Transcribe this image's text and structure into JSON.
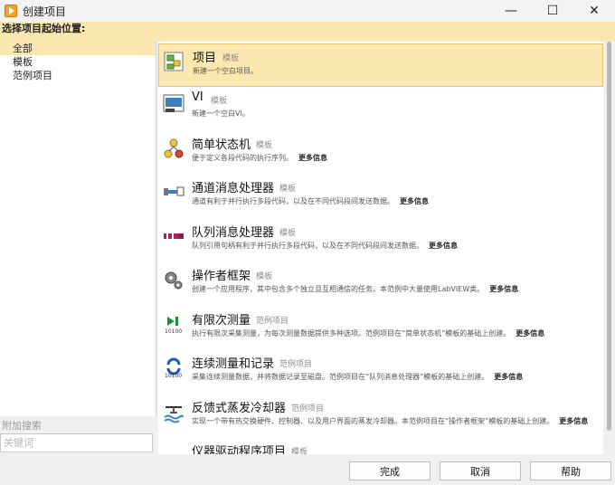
{
  "window": {
    "title": "创建项目",
    "minimize": "—",
    "maximize": "☐",
    "close": "✕"
  },
  "header": {
    "label": "选择项目起始位置:"
  },
  "tree": {
    "items": [
      "全部",
      "模板",
      "范例项目"
    ]
  },
  "search": {
    "label": "附加搜索",
    "placeholder": "关键词"
  },
  "items": [
    {
      "name": "项目",
      "type": "模板",
      "desc": "新建一个空白项目。",
      "more": "",
      "icon": "project-icon"
    },
    {
      "name": "VI",
      "type": "模板",
      "desc": "新建一个空白VI。",
      "more": "",
      "icon": "vi-icon"
    },
    {
      "name": "简单状态机",
      "type": "模板",
      "desc": "便于定义各段代码的执行序列。",
      "more": "更多信息",
      "icon": "state-machine-icon"
    },
    {
      "name": "通道消息处理器",
      "type": "模板",
      "desc": "通道有利于并行执行多段代码，以及在不同代码段间发送数据。",
      "more": "更多信息",
      "icon": "channel-icon"
    },
    {
      "name": "队列消息处理器",
      "type": "模板",
      "desc": "队列引用句柄有利于并行执行多段代码，以及在不同代码段间发送数据。",
      "more": "更多信息",
      "icon": "queue-icon"
    },
    {
      "name": "操作者框架",
      "type": "模板",
      "desc": "创建一个应用程序，其中包含多个独立且互相通信的任务。本范例中大量使用LabVIEW类。",
      "more": "更多信息",
      "icon": "gears-icon"
    },
    {
      "name": "有限次测量",
      "type": "范例项目",
      "desc": "执行有限次采集测量，为每次测量数据提供多种选项。范例项目在“简单状态机”模板的基础上创建。",
      "more": "更多信息",
      "icon": "finite-measure-icon"
    },
    {
      "name": "连续测量和记录",
      "type": "范例项目",
      "desc": "采集连续测量数据，并将数据记录至磁盘。范例项目在“队列消息处理器”模板的基础上创建。",
      "more": "更多信息",
      "icon": "continuous-log-icon"
    },
    {
      "name": "反馈式蒸发冷却器",
      "type": "范例项目",
      "desc": "实现一个带有热交换硬件、控制器、以及用户界面的蒸发冷却器。本范例项目在“操作者框架”模板的基础上创建。",
      "more": "更多信息",
      "icon": "cooler-icon"
    },
    {
      "name": "仪器驱动程序项目",
      "type": "模板",
      "desc": "",
      "more": "",
      "icon": "instrument-icon"
    }
  ],
  "buttons": {
    "finish": "完成",
    "cancel": "取消",
    "help": "帮助"
  }
}
